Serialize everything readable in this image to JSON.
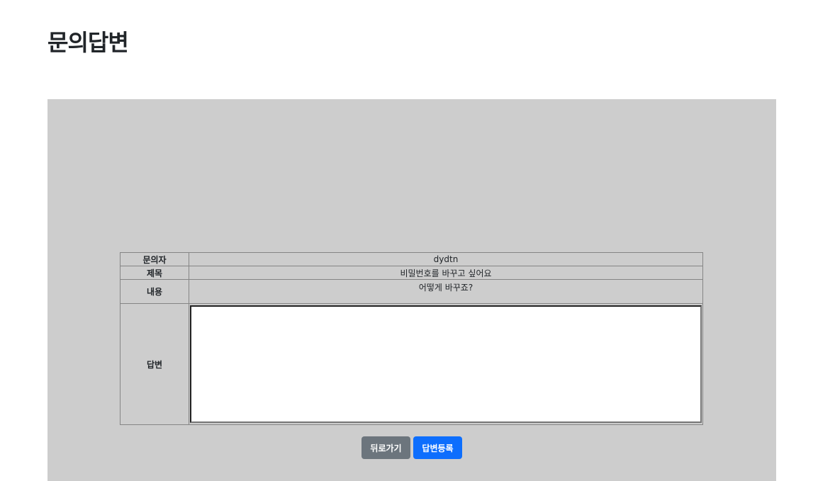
{
  "page": {
    "title": "문의답변"
  },
  "inquiry": {
    "inquirer_label": "문의자",
    "inquirer_value": "dydtn",
    "subject_label": "제목",
    "subject_value": "비밀번호를 바꾸고 싶어요",
    "content_label": "내용",
    "content_value": "어떻게 바꾸죠?",
    "answer_label": "답변",
    "answer_value": ""
  },
  "actions": {
    "back_label": "뒤로가기",
    "submit_label": "답변등록"
  },
  "colors": {
    "panel_bg": "#cdcdcd",
    "back_button": "#6c757d",
    "submit_button": "#0d6efd"
  }
}
